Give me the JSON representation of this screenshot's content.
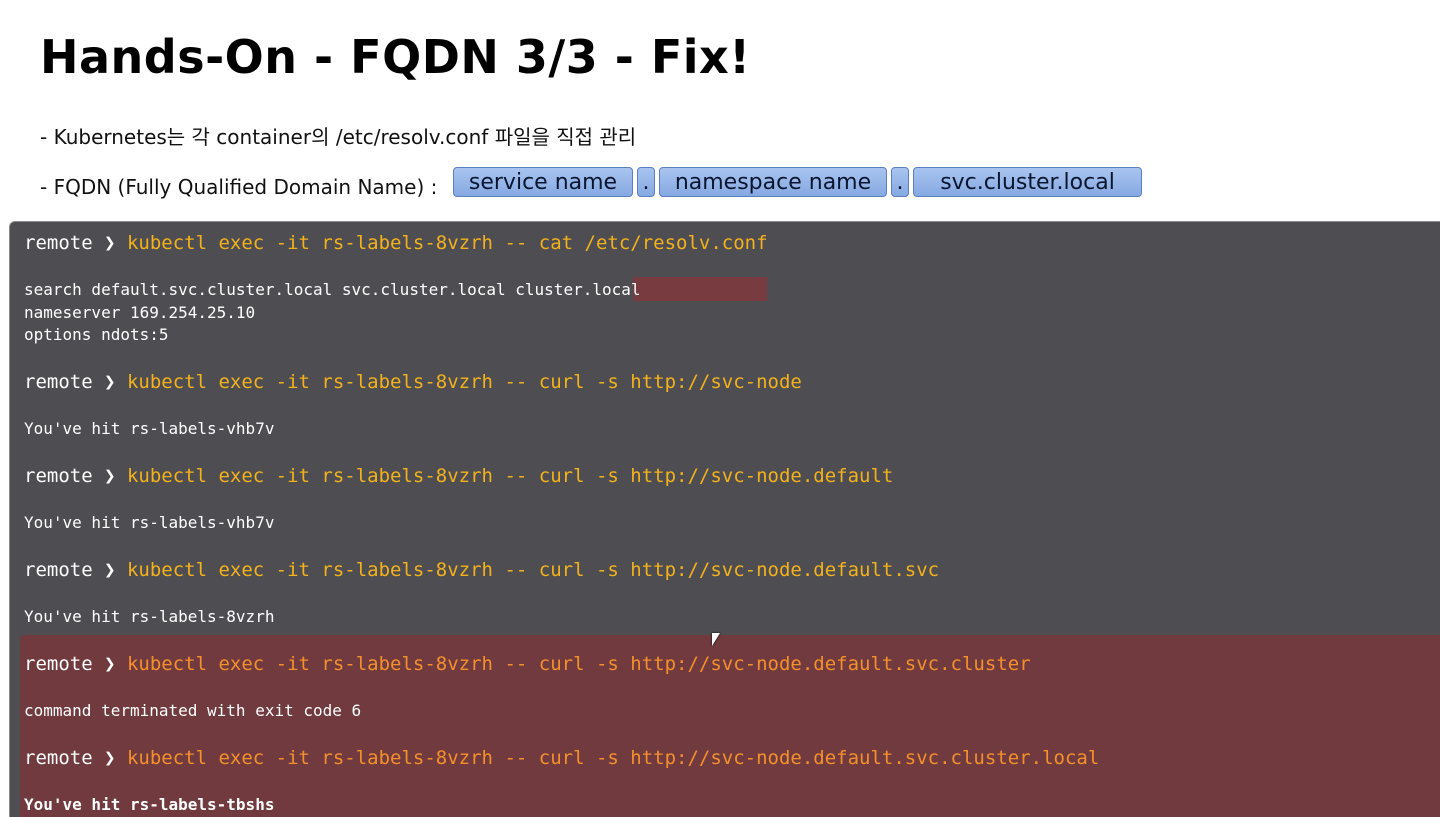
{
  "slide": {
    "title": "Hands-On - FQDN 3/3 - Fix!",
    "bullet_1": "- Kubernetes는 각 container의 /etc/resolv.conf 파일을 직접 관리",
    "bullet_2": "- FQDN (Fully Qualified Domain Name) :",
    "fqdn_parts": {
      "service": "service name",
      "dot1": ".",
      "namespace": "namespace name",
      "dot2": ".",
      "cluster": "svc.cluster.local"
    }
  },
  "terminal": {
    "colors": {
      "background": "#4e4d52",
      "highlight": "#713a3e",
      "command": "#f3b21c",
      "command_highlight": "#f4902c"
    },
    "prompt": "remote ❯ ",
    "blocks": [
      {
        "command": "kubectl exec -it rs-labels-8vzrh -- cat /etc/resolv.conf",
        "output": [
          "search default.svc.cluster.local svc.cluster.local cluster.local",
          "nameserver 169.254.25.10",
          "options ndots:5"
        ]
      },
      {
        "command": "kubectl exec -it rs-labels-8vzrh -- curl -s http://svc-node",
        "output": [
          "You've hit rs-labels-vhb7v"
        ]
      },
      {
        "command": "kubectl exec -it rs-labels-8vzrh -- curl -s http://svc-node.default",
        "output": [
          "You've hit rs-labels-vhb7v"
        ]
      },
      {
        "command": "kubectl exec -it rs-labels-8vzrh -- curl -s http://svc-node.default.svc",
        "output": [
          "You've hit rs-labels-8vzrh"
        ]
      },
      {
        "command": "kubectl exec -it rs-labels-8vzrh -- curl -s http://svc-node.default.svc.cluster",
        "output": [
          "command terminated with exit code 6"
        ]
      },
      {
        "command": "kubectl exec -it rs-labels-8vzrh -- curl -s http://svc-node.default.svc.cluster.local",
        "output": [
          "You've hit rs-labels-tbshs"
        ]
      }
    ]
  }
}
